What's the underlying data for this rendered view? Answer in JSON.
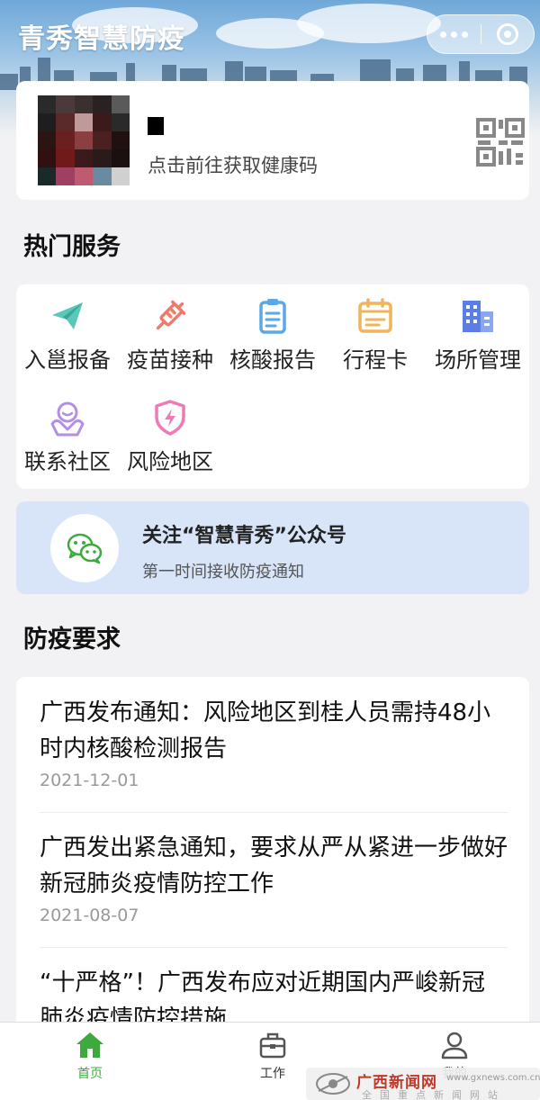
{
  "header": {
    "app_title": "青秀智慧防疫",
    "menu_icon": "more-dots-icon",
    "close_icon": "close-circle-icon"
  },
  "profile": {
    "health_code_link": "点击前往获取健康码",
    "qr_icon": "qr-code-icon"
  },
  "hot_services": {
    "title": "热门服务",
    "items": [
      {
        "label": "入邕报备",
        "icon": "paper-plane-icon",
        "color": "#5ac8b8"
      },
      {
        "label": "疫苗接种",
        "icon": "syringe-icon",
        "color": "#f07a6a"
      },
      {
        "label": "核酸报告",
        "icon": "clipboard-icon",
        "color": "#5aa8e6"
      },
      {
        "label": "行程卡",
        "icon": "calendar-icon",
        "color": "#f0b45a"
      },
      {
        "label": "场所管理",
        "icon": "building-icon",
        "color": "#5a7ee6"
      },
      {
        "label": "联系社区",
        "icon": "people-icon",
        "color": "#b48ee0"
      },
      {
        "label": "风险地区",
        "icon": "shield-bolt-icon",
        "color": "#f07ab4"
      }
    ]
  },
  "wechat": {
    "title": "关注“智慧青秀”公众号",
    "subtitle": "第一时间接收防疫通知",
    "icon": "wechat-icon"
  },
  "requirements": {
    "title": "防疫要求",
    "news": [
      {
        "title": "广西发布通知：风险地区到桂人员需持48小时内核酸检测报告",
        "date": "2021-12-01"
      },
      {
        "title": "广西发出紧急通知，要求从严从紧进一步做好新冠肺炎疫情防控工作",
        "date": "2021-08-07"
      },
      {
        "title": "“十严格”！广西发布应对近期国内严峻新冠肺炎疫情防控措施",
        "date": ""
      }
    ]
  },
  "tabbar": {
    "tabs": [
      {
        "label": "首页",
        "icon": "home-icon",
        "active": true
      },
      {
        "label": "工作",
        "icon": "briefcase-icon",
        "active": false
      },
      {
        "label": "我的",
        "icon": "user-icon",
        "active": false
      }
    ],
    "active_color": "#3eaa3e"
  },
  "watermark": {
    "name": "广西新闻网",
    "url": "www.gxnews.com.cn",
    "subtitle": "全国重点新闻网站"
  }
}
